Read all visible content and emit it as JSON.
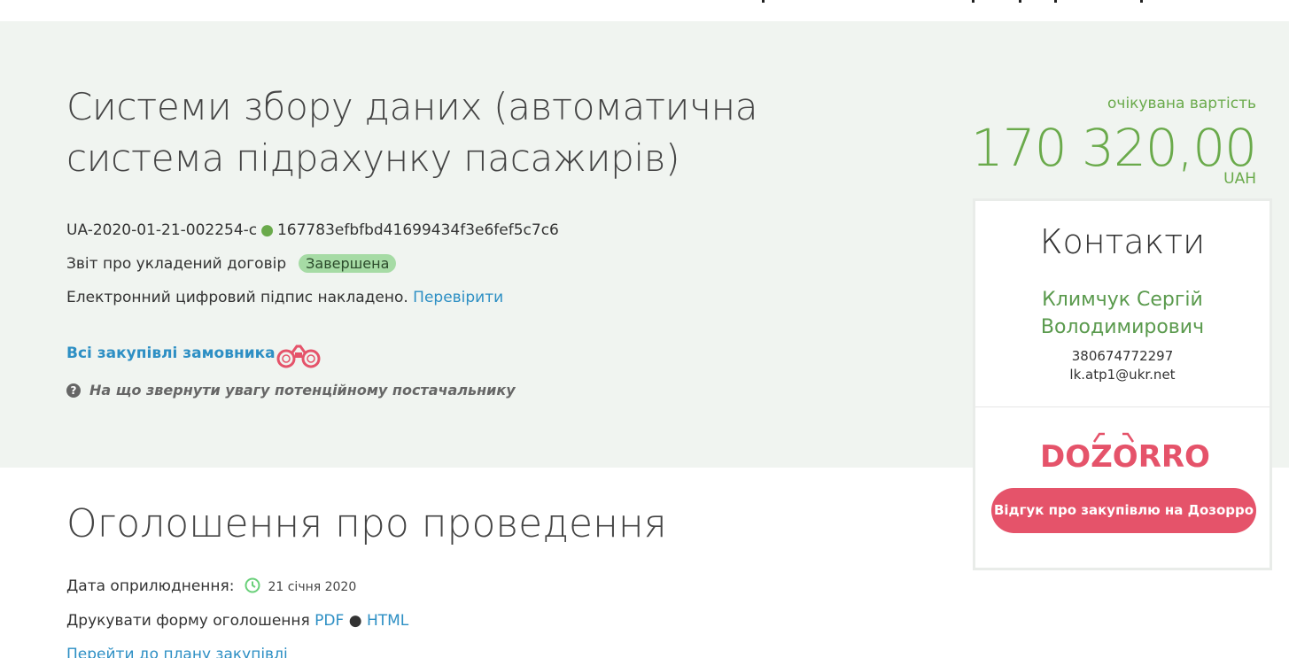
{
  "tender": {
    "title": "Системи збору даних (автоматична система підрахунку пасажирів)",
    "id": "UA-2020-01-21-002254-c",
    "hash": "167783efbfbd41699434f3e6fef5c7c6",
    "type": "Звіт про укладений договір",
    "status": "Завершена",
    "signature_text": "Електронний цифровий підпис накладено.",
    "verify_link": "Перевірити",
    "all_purchases": "Всі закупівлі замовника",
    "hint": "На що звернути увагу потенційному постачальнику"
  },
  "price": {
    "label": "очікувана вартість",
    "amount": "170 320,00",
    "currency": "UAH"
  },
  "contacts": {
    "heading": "Контакти",
    "name": "Климчук Сергій Володимирович",
    "phone": "380674772297",
    "email": "lk.atp1@ukr.net",
    "logo_text": "DOZORRO",
    "dozorro_button": "Відгук про закупівлю на Дозорро"
  },
  "announcement": {
    "heading": "Оголошення про проведення",
    "pub_label": "Дата оприлюднення:",
    "pub_date": "21 січня 2020",
    "print_label": "Друкувати форму оголошення",
    "pdf": "PDF",
    "bullet": "●",
    "html": "HTML",
    "plan_link": "Перейти до плану закупівлі"
  },
  "colors": {
    "accent_green": "#6aaa4b",
    "link_blue": "#2d8fc4",
    "dozorro_pink": "#e5536a",
    "hero_bg": "#f0f4f0"
  },
  "icons": [
    "binoculars-icon",
    "question-circle-icon",
    "clock-icon",
    "dozorro-logo"
  ]
}
